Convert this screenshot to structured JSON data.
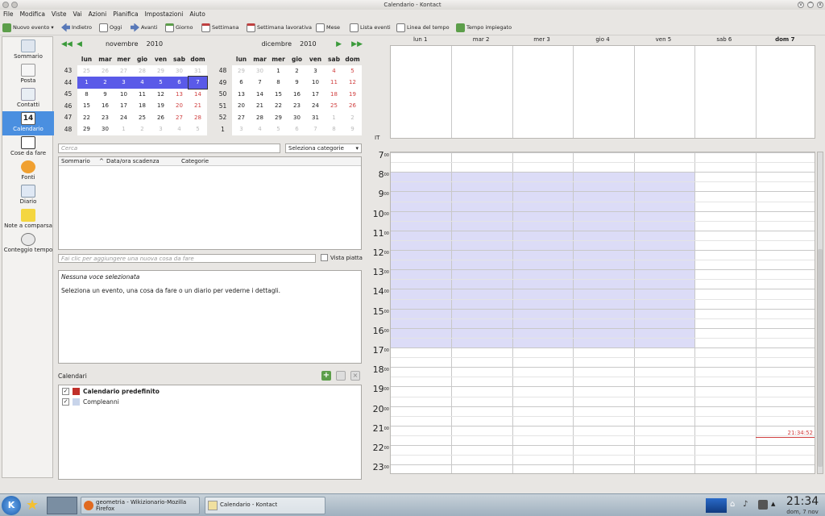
{
  "window": {
    "title": "Calendario - Kontact"
  },
  "menu": [
    "File",
    "Modifica",
    "Viste",
    "Vai",
    "Azioni",
    "Pianifica",
    "Impostazioni",
    "Aiuto"
  ],
  "toolbar": {
    "new_event": "Nuovo evento",
    "back": "Indietro",
    "today": "Oggi",
    "forward": "Avanti",
    "day": "Giorno",
    "week": "Settimana",
    "work_week": "Settimana lavorativa",
    "month": "Mese",
    "event_list": "Lista eventi",
    "timeline": "Linea del tempo",
    "time_spent": "Tempo impiegato"
  },
  "sidebar": [
    {
      "label": "Sommario",
      "icon": "summary-icon"
    },
    {
      "label": "Posta",
      "icon": "mail-icon"
    },
    {
      "label": "Contatti",
      "icon": "contacts-icon"
    },
    {
      "label": "Calendario",
      "icon": "calendar-icon",
      "selected": true,
      "badge": "14"
    },
    {
      "label": "Cose da fare",
      "icon": "todo-icon"
    },
    {
      "label": "Fonti",
      "icon": "feeds-icon"
    },
    {
      "label": "Diario",
      "icon": "journal-icon"
    },
    {
      "label": "Note a comparsa",
      "icon": "notes-icon"
    },
    {
      "label": "Conteggio tempo",
      "icon": "timetracker-icon"
    }
  ],
  "mini_cal_left": {
    "month": "novembre",
    "year": "2010",
    "days": [
      "lun",
      "mar",
      "mer",
      "gio",
      "ven",
      "sab",
      "dom"
    ],
    "weeks": [
      {
        "wk": "43",
        "d": [
          "25",
          "26",
          "27",
          "28",
          "29",
          "30",
          "31"
        ],
        "other": [
          1,
          1,
          1,
          1,
          1,
          1,
          1
        ]
      },
      {
        "wk": "44",
        "d": [
          "1",
          "2",
          "3",
          "4",
          "5",
          "6",
          "7"
        ],
        "sel": true
      },
      {
        "wk": "45",
        "d": [
          "8",
          "9",
          "10",
          "11",
          "12",
          "13",
          "14"
        ]
      },
      {
        "wk": "46",
        "d": [
          "15",
          "16",
          "17",
          "18",
          "19",
          "20",
          "21"
        ]
      },
      {
        "wk": "47",
        "d": [
          "22",
          "23",
          "24",
          "25",
          "26",
          "27",
          "28"
        ]
      },
      {
        "wk": "48",
        "d": [
          "29",
          "30",
          "1",
          "2",
          "3",
          "4",
          "5"
        ],
        "other": [
          0,
          0,
          1,
          1,
          1,
          1,
          1
        ]
      }
    ]
  },
  "mini_cal_right": {
    "month": "dicembre",
    "year": "2010",
    "days": [
      "lun",
      "mar",
      "mer",
      "gio",
      "ven",
      "sab",
      "dom"
    ],
    "weeks": [
      {
        "wk": "48",
        "d": [
          "29",
          "30",
          "1",
          "2",
          "3",
          "4",
          "5"
        ],
        "other": [
          1,
          1,
          0,
          0,
          0,
          0,
          0
        ]
      },
      {
        "wk": "49",
        "d": [
          "6",
          "7",
          "8",
          "9",
          "10",
          "11",
          "12"
        ]
      },
      {
        "wk": "50",
        "d": [
          "13",
          "14",
          "15",
          "16",
          "17",
          "18",
          "19"
        ]
      },
      {
        "wk": "51",
        "d": [
          "20",
          "21",
          "22",
          "23",
          "24",
          "25",
          "26"
        ]
      },
      {
        "wk": "52",
        "d": [
          "27",
          "28",
          "29",
          "30",
          "31",
          "1",
          "2"
        ],
        "other": [
          0,
          0,
          0,
          0,
          0,
          1,
          1
        ]
      },
      {
        "wk": "1",
        "d": [
          "3",
          "4",
          "5",
          "6",
          "7",
          "8",
          "9"
        ],
        "other": [
          1,
          1,
          1,
          1,
          1,
          1,
          1
        ]
      }
    ]
  },
  "todo": {
    "search_placeholder": "Cerca",
    "category_select": "Seleziona categorie",
    "columns": [
      "Sommario",
      "Data/ora scadenza",
      "Categorie"
    ],
    "add_placeholder": "Fai clic per aggiungere una nuova cosa da fare",
    "flat_view": "Vista piatta"
  },
  "detail": {
    "title": "Nessuna voce selezionata",
    "text": "Seleziona un evento, una cosa da fare o un diario per vederne i dettagli."
  },
  "calendars": {
    "label": "Calendari",
    "items": [
      {
        "name": "Calendario predefinito",
        "color": "#c0302a",
        "bold": true
      },
      {
        "name": "Compleanni",
        "color": "#c8d4ea",
        "bold": false
      }
    ]
  },
  "agenda": {
    "days": [
      "lun 1",
      "mar 2",
      "mer 3",
      "gio 4",
      "ven 5",
      "sab 6",
      "dom 7"
    ],
    "today_index": 6,
    "timezone": "IT",
    "hours": [
      "7",
      "8",
      "9",
      "10",
      "11",
      "12",
      "13",
      "14",
      "15",
      "16",
      "17",
      "18",
      "19",
      "20",
      "21",
      "22",
      "23"
    ],
    "minutes": "00",
    "work_hours": {
      "start": 8,
      "end": 17,
      "days": 5
    },
    "current_time": "21:34:52"
  },
  "taskbar": {
    "tasks": [
      "geometria - Wikizionario-Mozilla Firefox",
      "Calendario - Kontact"
    ],
    "clock": "21:34",
    "date": "dom, 7 nov"
  },
  "colors": {
    "selection": "#5a5ae8",
    "weekend": "#d04040",
    "workhours": "#dcdcf7",
    "now_line": "#d04040",
    "sidebar_sel": "#4a8fe0"
  }
}
